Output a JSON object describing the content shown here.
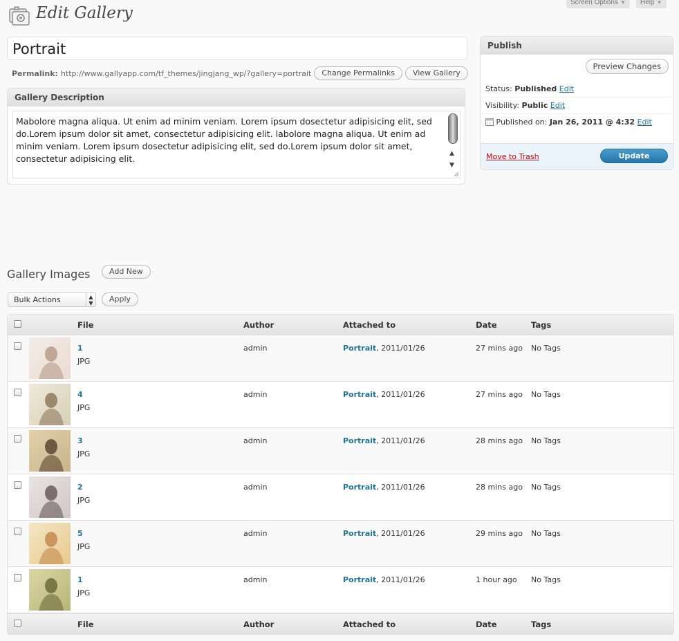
{
  "screen_meta": {
    "screen_options": "Screen Options",
    "help": "Help"
  },
  "page": {
    "title": "Edit Gallery"
  },
  "post_title": "Portrait",
  "permalink": {
    "label": "Permalink:",
    "url": "http://www.gallyapp.com/tf_themes/jingjang_wp/?gallery=portrait",
    "change_button": "Change Permalinks",
    "view_button": "View Gallery"
  },
  "description": {
    "heading": "Gallery Description",
    "text": "Mabolore magna aliqua. Ut enim ad minim veniam. Lorem ipsum dosectetur adipisicing elit, sed do.Lorem ipsum dolor sit amet, consectetur adipisicing elit. labolore magna aliqua. Ut enim ad minim veniam. Lorem ipsum dosectetur adipisicing elit, sed do.Lorem ipsum dolor sit amet, consectetur adipisicing elit."
  },
  "publish": {
    "heading": "Publish",
    "preview_button": "Preview Changes",
    "status_label": "Status:",
    "status_value": "Published",
    "visibility_label": "Visibility:",
    "visibility_value": "Public",
    "published_label": "Published on:",
    "published_value": "Jan 26, 2011 @ 4:32",
    "edit": "Edit",
    "trash": "Move to Trash",
    "update_button": "Update"
  },
  "images": {
    "heading": "Gallery Images",
    "add_new": "Add New",
    "bulk_actions": "Bulk Actions",
    "apply": "Apply",
    "columns": {
      "file": "File",
      "author": "Author",
      "attached": "Attached to",
      "date": "Date",
      "tags": "Tags"
    },
    "rows": [
      {
        "file": "1",
        "type": "JPG",
        "author": "admin",
        "attached": "Portrait",
        "attached_date": ", 2011/01/26",
        "date": "27 mins ago",
        "tags": "No Tags"
      },
      {
        "file": "4",
        "type": "JPG",
        "author": "admin",
        "attached": "Portrait",
        "attached_date": ", 2011/01/26",
        "date": "27 mins ago",
        "tags": "No Tags"
      },
      {
        "file": "3",
        "type": "JPG",
        "author": "admin",
        "attached": "Portrait",
        "attached_date": ", 2011/01/26",
        "date": "28 mins ago",
        "tags": "No Tags"
      },
      {
        "file": "2",
        "type": "JPG",
        "author": "admin",
        "attached": "Portrait",
        "attached_date": ", 2011/01/26",
        "date": "28 mins ago",
        "tags": "No Tags"
      },
      {
        "file": "5",
        "type": "JPG",
        "author": "admin",
        "attached": "Portrait",
        "attached_date": ", 2011/01/26",
        "date": "29 mins ago",
        "tags": "No Tags"
      },
      {
        "file": "1",
        "type": "JPG",
        "author": "admin",
        "attached": "Portrait",
        "attached_date": ", 2011/01/26",
        "date": "1 hour ago",
        "tags": "No Tags"
      }
    ]
  }
}
